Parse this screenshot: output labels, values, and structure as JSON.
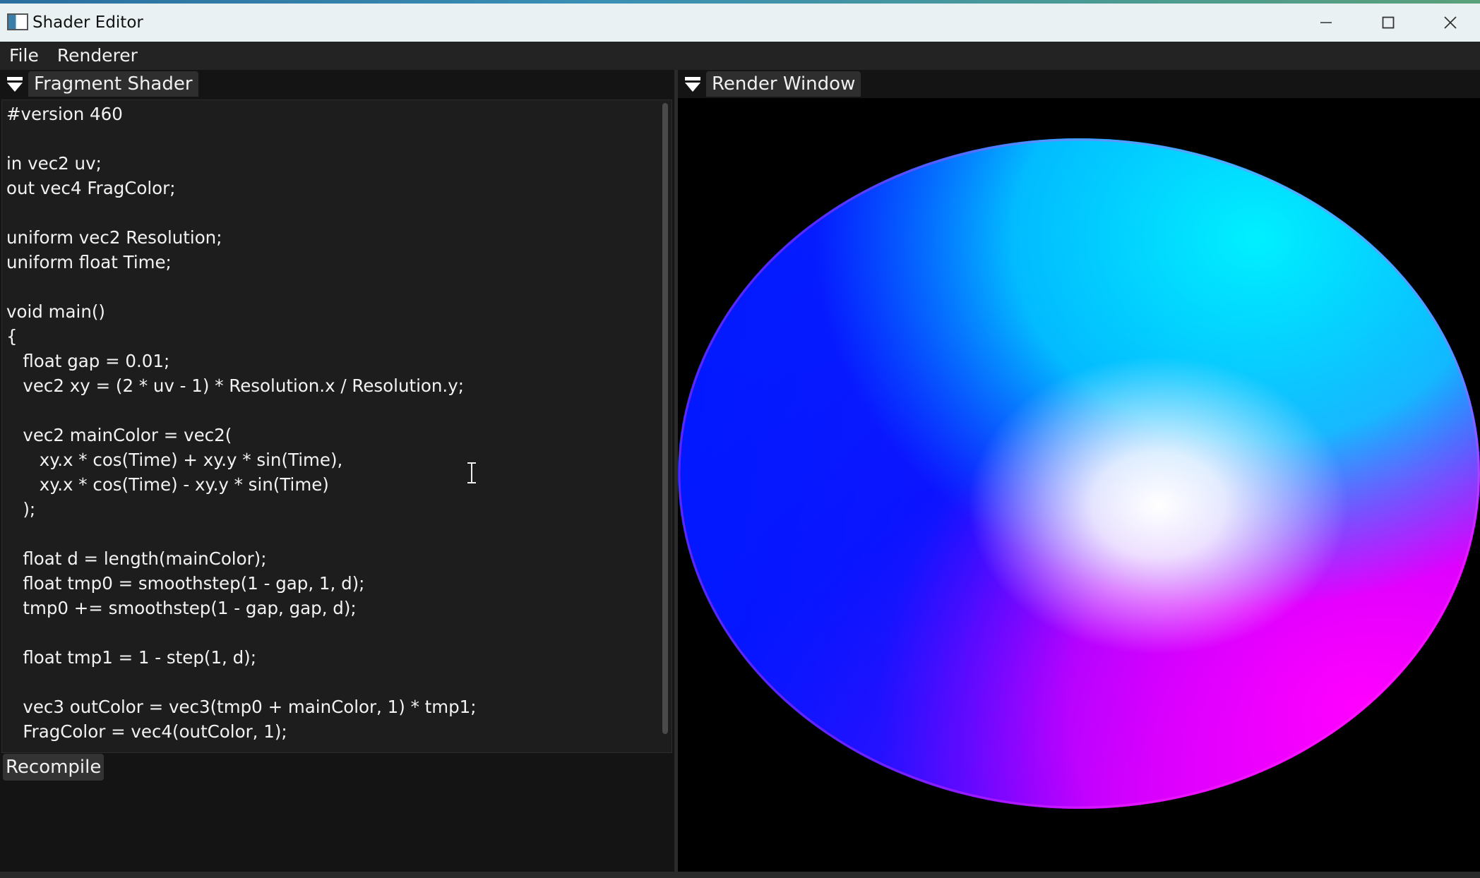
{
  "window": {
    "title": "Shader Editor",
    "controls": {
      "minimize_icon": "minimize-icon",
      "maximize_icon": "maximize-icon",
      "close_icon": "close-icon"
    }
  },
  "menu": {
    "items": [
      {
        "label": "File"
      },
      {
        "label": "Renderer"
      }
    ]
  },
  "fragment_panel": {
    "tab_label": "Fragment Shader",
    "code_lines": [
      "#version 460",
      "",
      "in vec2 uv;",
      "out vec4 FragColor;",
      "",
      "uniform vec2 Resolution;",
      "uniform float Time;",
      "",
      "void main()",
      "{",
      "   float gap = 0.01;",
      "   vec2 xy = (2 * uv - 1) * Resolution.x / Resolution.y;",
      "",
      "   vec2 mainColor = vec2(",
      "      xy.x * cos(Time) + xy.y * sin(Time),",
      "      xy.x * cos(Time) - xy.y * sin(Time)",
      "   );",
      "",
      "   float d = length(mainColor);",
      "   float tmp0 = smoothstep(1 - gap, 1, d);",
      "   tmp0 += smoothstep(1 - gap, gap, d);",
      "",
      "   float tmp1 = 1 - step(1, d);",
      "",
      "   vec3 outColor = vec3(tmp0 + mainColor, 1) * tmp1;",
      "   FragColor = vec4(outColor, 1);"
    ],
    "recompile_label": "Recompile"
  },
  "render_panel": {
    "tab_label": "Render Window"
  },
  "colors": {
    "accent": "#3a8fb5",
    "render_cyan": "#00e5ff",
    "render_blue": "#0010ff",
    "render_magenta": "#ff00ff",
    "render_white": "#ffffff"
  }
}
